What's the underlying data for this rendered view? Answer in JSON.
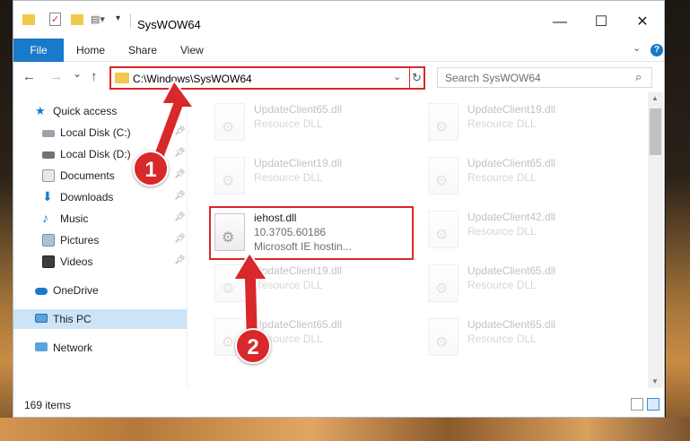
{
  "window": {
    "title": "SysWOW64",
    "quick_access_toolbar": [
      "folder-icon",
      "properties-check-icon",
      "new-folder-icon",
      "customize-icon",
      "dropdown-arrow-icon"
    ],
    "controls": {
      "minimize": "—",
      "maximize": "☐",
      "close": "✕"
    }
  },
  "ribbon": {
    "tabs": [
      "File",
      "Home",
      "Share",
      "View"
    ],
    "help": "?"
  },
  "navigation": {
    "back": "←",
    "forward": "→",
    "recent": "⌄",
    "up": "↑",
    "address": "C:\\Windows\\SysWOW64",
    "search_placeholder": "Search SysWOW64"
  },
  "sidebar": {
    "items": [
      {
        "label": "Quick access",
        "icon": "star-icon",
        "pinned": false
      },
      {
        "label": "Local Disk (C:)",
        "icon": "drive-icon",
        "pinned": true
      },
      {
        "label": "Local Disk (D:)",
        "icon": "drive-icon",
        "pinned": true
      },
      {
        "label": "Documents",
        "icon": "documents-icon",
        "pinned": true
      },
      {
        "label": "Downloads",
        "icon": "download-icon",
        "pinned": true
      },
      {
        "label": "Music",
        "icon": "music-icon",
        "pinned": true
      },
      {
        "label": "Pictures",
        "icon": "pictures-icon",
        "pinned": true
      },
      {
        "label": "Videos",
        "icon": "videos-icon",
        "pinned": true
      },
      {
        "label": "OneDrive",
        "icon": "onedrive-icon",
        "pinned": false
      },
      {
        "label": "This PC",
        "icon": "pc-icon",
        "pinned": false,
        "selected": true
      },
      {
        "label": "Network",
        "icon": "network-icon",
        "pinned": false
      }
    ]
  },
  "files": [
    {
      "name": "UpdateClient65.dll",
      "line2": "Resource DLL",
      "line3": ""
    },
    {
      "name": "UpdateClient19.dll",
      "line2": "Resource DLL",
      "line3": ""
    },
    {
      "name": "UpdateClient19.dll",
      "line2": "Resource DLL",
      "line3": ""
    },
    {
      "name": "UpdateClient65.dll",
      "line2": "Resource DLL",
      "line3": ""
    },
    {
      "name": "iehost.dll",
      "line2": "10.3705.60186",
      "line3": "Microsoft IE hostin...",
      "highlighted": true
    },
    {
      "name": "UpdateClient42.dll",
      "line2": "Resource DLL",
      "line3": ""
    },
    {
      "name": "UpdateClient19.dll",
      "line2": "Resource DLL",
      "line3": ""
    },
    {
      "name": "UpdateClient65.dll",
      "line2": "Resource DLL",
      "line3": ""
    },
    {
      "name": "UpdateClient65.dll",
      "line2": "Resource DLL",
      "line3": ""
    },
    {
      "name": "UpdateClient65.dll",
      "line2": "Resource DLL",
      "line3": ""
    }
  ],
  "status": {
    "item_count": "169 items"
  },
  "annotations": [
    {
      "number": "1",
      "color": "#d9282a"
    },
    {
      "number": "2",
      "color": "#d9282a"
    }
  ]
}
